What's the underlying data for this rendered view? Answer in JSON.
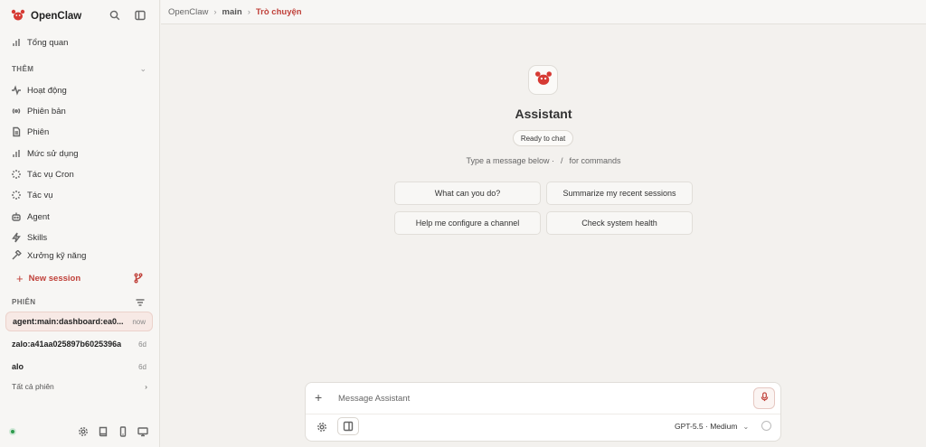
{
  "brand": {
    "name": "OpenClaw"
  },
  "sidebar": {
    "overview": "Tổng quan",
    "section_more": "THÊM",
    "items": [
      {
        "label": "Hoạt động",
        "icon": "activity-icon"
      },
      {
        "label": "Phiên bản",
        "icon": "broadcast-icon"
      },
      {
        "label": "Phiên",
        "icon": "document-icon"
      },
      {
        "label": "Mức sử dụng",
        "icon": "bar-chart-icon"
      },
      {
        "label": "Tác vụ Cron",
        "icon": "loader-icon"
      },
      {
        "label": "Tác vụ",
        "icon": "loader-icon"
      },
      {
        "label": "Agent",
        "icon": "robot-icon"
      },
      {
        "label": "Skills",
        "icon": "bolt-icon"
      },
      {
        "label": "Xưởng kỹ năng",
        "icon": "hammer-icon"
      }
    ],
    "new_session": "New session",
    "sessions_label": "PHIÊN",
    "sessions": [
      {
        "name": "agent:main:dashboard:ea0...",
        "time": "now"
      },
      {
        "name": "zalo:a41aa025897b6025396a",
        "time": "6d"
      },
      {
        "name": "alo",
        "time": "6d"
      }
    ],
    "all_sessions": "Tất cả phiên"
  },
  "breadcrumb": {
    "root": "OpenClaw",
    "middle": "main",
    "current": "Trò chuyện"
  },
  "main": {
    "title": "Assistant",
    "badge": "Ready to chat",
    "hint_prefix": "Type a message below ·",
    "hint_slash": "/",
    "hint_suffix": "for commands",
    "suggestions": [
      "What can you do?",
      "Summarize my recent sessions",
      "Help me configure a channel",
      "Check system health"
    ]
  },
  "composer": {
    "placeholder": "Message Assistant",
    "model": "GPT-5.5 · Medium"
  },
  "colors": {
    "accent": "#c0413a",
    "status_online": "#2e9a4c"
  }
}
